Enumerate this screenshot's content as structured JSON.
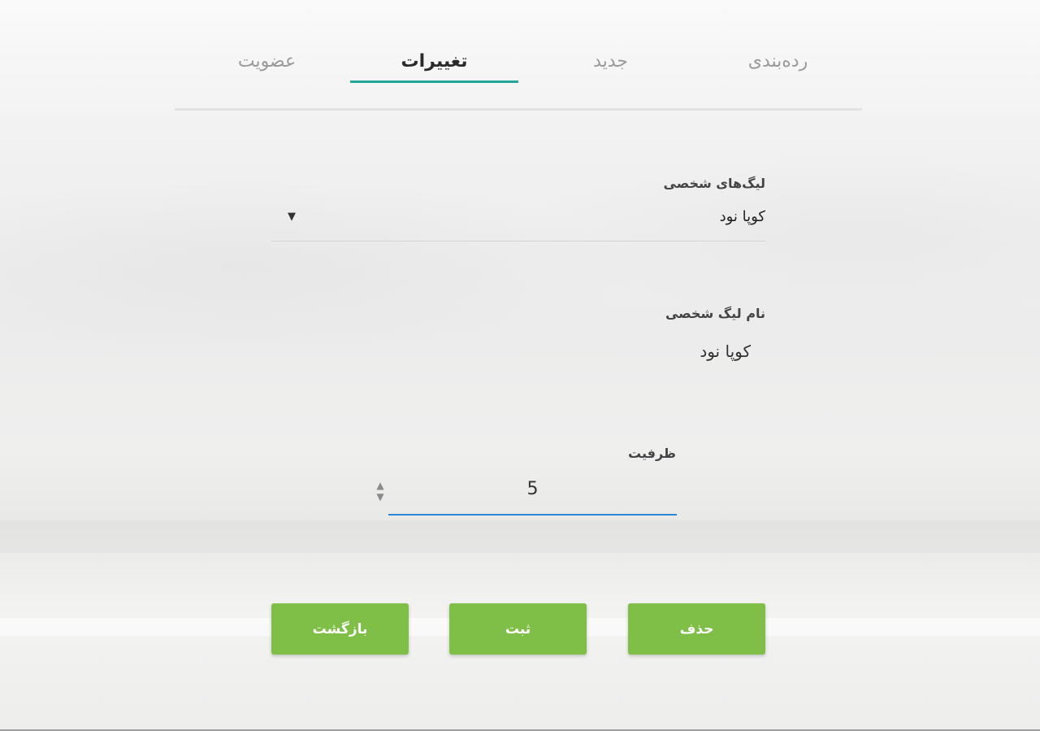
{
  "tabs": [
    {
      "label": "رده‌بندی",
      "active": false
    },
    {
      "label": "جدید",
      "active": false
    },
    {
      "label": "تغییرات",
      "active": true
    },
    {
      "label": "عضویت",
      "active": false
    }
  ],
  "leagues_field": {
    "label": "لیگ‌های شخصی",
    "value": "کوپا نود"
  },
  "league_name": {
    "label": "نام لیگ شخصی",
    "value": "کوپا نود"
  },
  "capacity": {
    "label": "ظرفیت",
    "value": "5"
  },
  "buttons": {
    "delete": "حذف",
    "submit": "ثبت",
    "back": "بازگشت"
  },
  "colors": {
    "accent": "#26a69a",
    "button": "#80bf47",
    "input_focus": "#2a88d6"
  }
}
